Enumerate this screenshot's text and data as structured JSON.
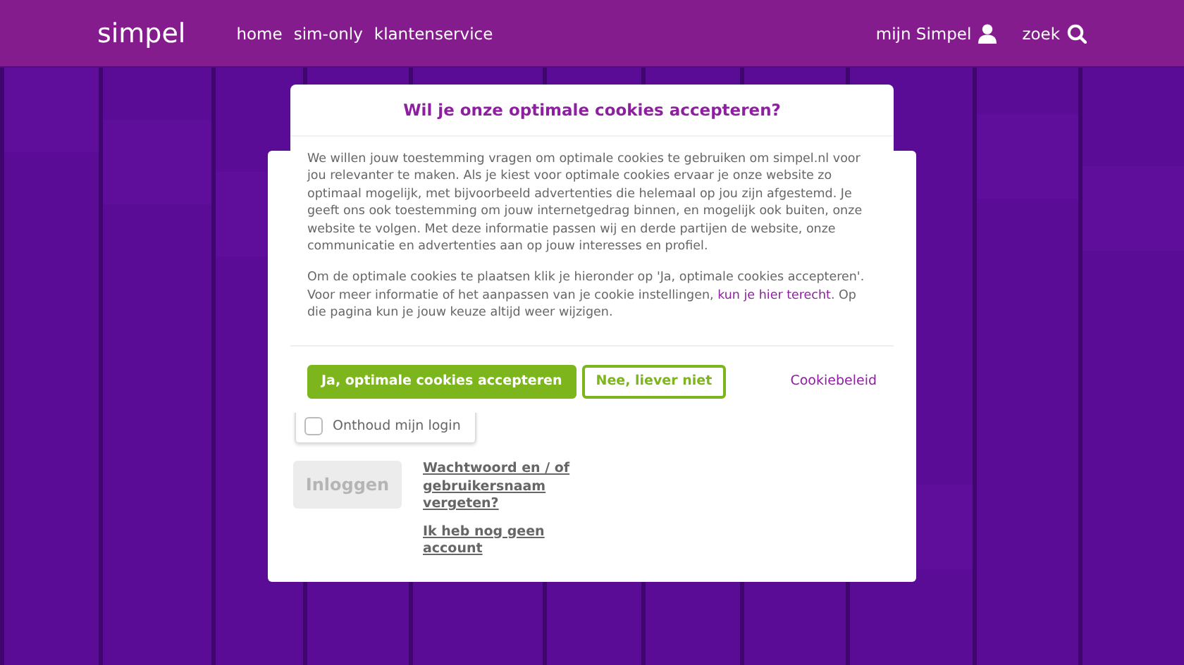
{
  "header": {
    "logo": "simpel",
    "nav": [
      "home",
      "sim-only",
      "klantenservice"
    ],
    "account": "mijn Simpel",
    "search": "zoek"
  },
  "login": {
    "remember": {
      "label": "Onthoud mijn login",
      "checked": false
    },
    "submit": {
      "label": "Inloggen",
      "disabled": true
    },
    "links": [
      "Wachtwoord en / of gebruikersnaam vergeten?",
      "Ik heb nog geen account"
    ]
  },
  "cookie_dialog": {
    "title": "Wil je onze optimale cookies accepteren?",
    "paragraph_1": "We willen jouw toestemming vragen om optimale cookies te gebruiken om simpel.nl voor jou relevanter te maken. Als je kiest voor optimale cookies ervaar je onze website zo optimaal mogelijk, met bijvoorbeeld advertenties die helemaal op jou zijn afgestemd. Je geeft ons ook toestemming om jouw internetgedrag binnen, en mogelijk ook buiten, onze website te volgen. Met deze informatie passen wij en derde partijen de website, onze communicatie en advertenties aan op jouw interesses en profiel.",
    "paragraph_2_before": "Om de optimale cookies te plaatsen klik je hieronder op 'Ja, optimale cookies accepteren'. Voor meer informatie of het aanpassen van je cookie instellingen,",
    "paragraph_2_link": "kun je hier terecht",
    "paragraph_2_after": ". Op die pagina kun je jouw keuze altijd weer wijzigen.",
    "accept": "Ja, optimale cookies accepteren",
    "decline": "Nee, liever niet",
    "policy": "Cookiebeleid"
  }
}
